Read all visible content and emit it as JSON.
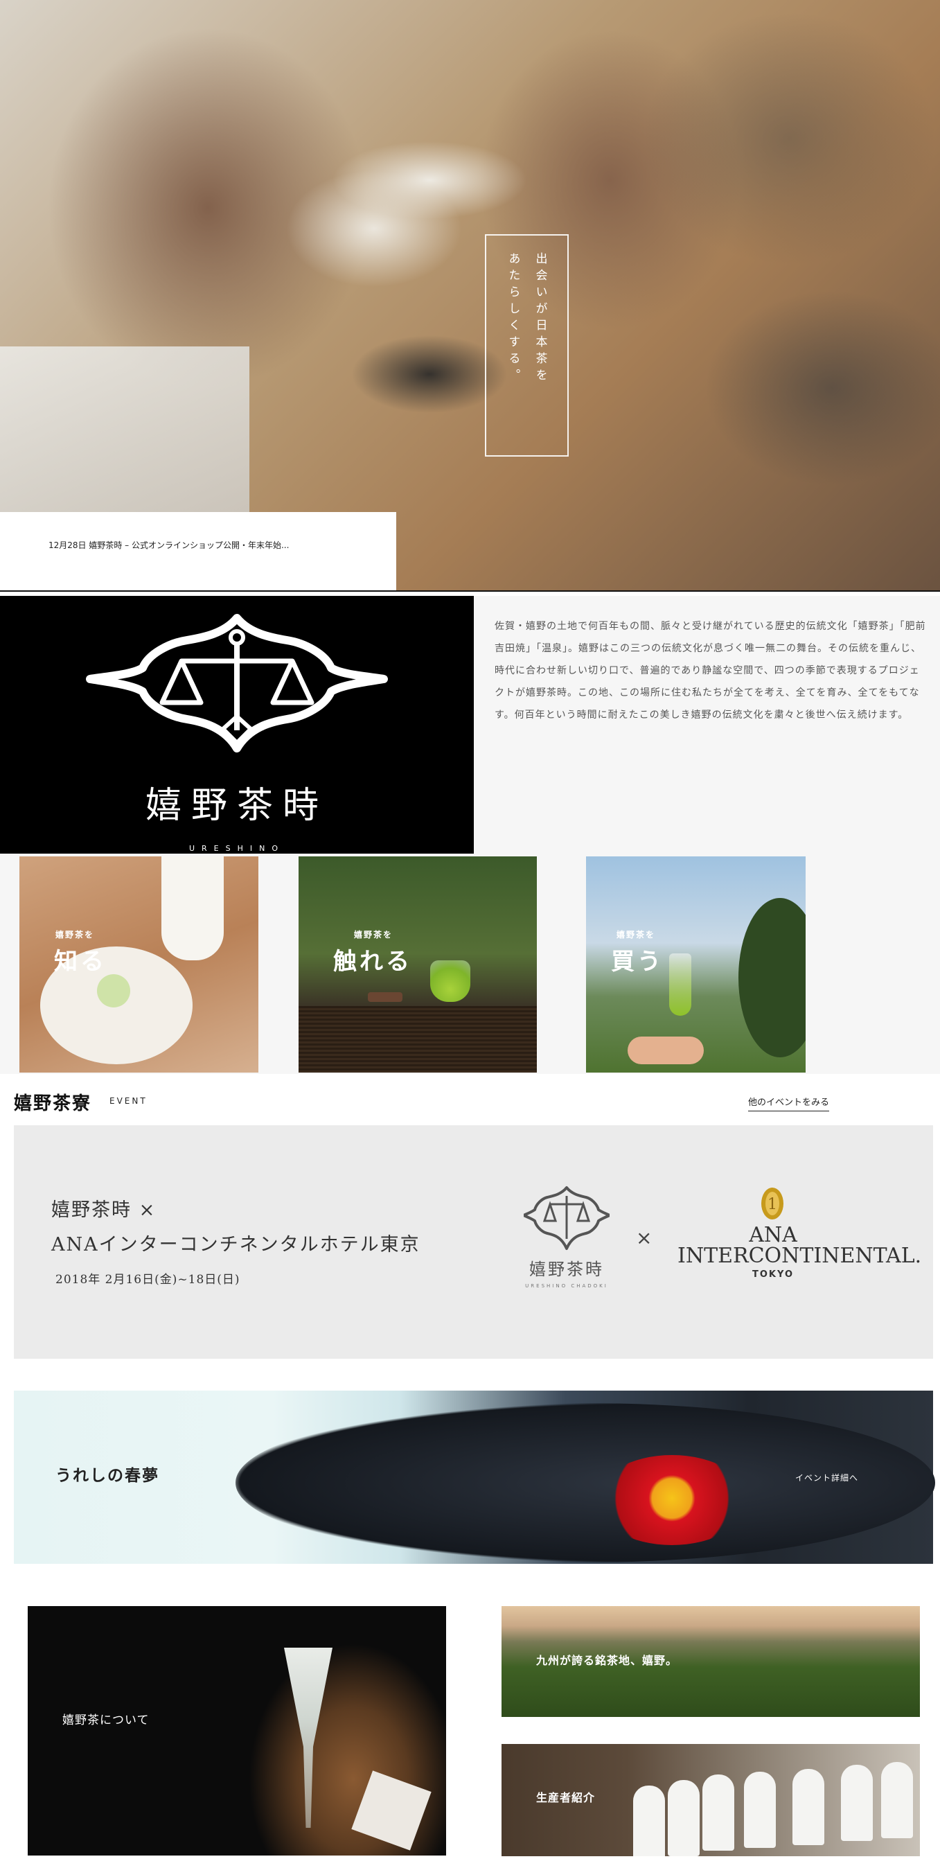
{
  "hero": {
    "tagline_line1": "出会いが日本茶を",
    "tagline_line2": "あたらしくする。",
    "news": "12月28日 嬉野茶時 – 公式オンラインショップ公開・年末年始..."
  },
  "logo": {
    "kanji": "嬉野茶時",
    "roman": "URESHINO"
  },
  "intro": {
    "text": "佐賀・嬉野の土地で何百年もの間、脈々と受け継がれている歴史的伝統文化「嬉野茶」「肥前吉田焼」「温泉」。嬉野はこの三つの伝統文化が息づく唯一無二の舞台。その伝統を重んじ、時代に合わせ新しい切り口で、普遍的であり静謐な空間で、四つの季節で表現するプロジェクトが嬉野茶時。この地、この場所に住む私たちが全てを考え、全てを育み、全てをもてなす。何百年という時間に耐えたこの美しき嬉野の伝統文化を粛々と後世へ伝え続けます。"
  },
  "cards": [
    {
      "sub": "嬉野茶を",
      "title": "知る"
    },
    {
      "sub": "嬉野茶を",
      "title": "触れる"
    },
    {
      "sub": "嬉野茶を",
      "title": "買う"
    }
  ],
  "event": {
    "section_title": "嬉野茶寮",
    "section_label": "EVENT",
    "more_link": "他のイベントをみる",
    "line1": "嬉野茶時 ×",
    "line2": "ANAインターコンチネンタルホテル東京",
    "date": "2018年 2月16日(金)~18日(日)",
    "logo_kanji": "嬉野茶時",
    "logo_roman": "URESHINO CHADOKI",
    "times": "×",
    "partner_name_line1": "ANA",
    "partner_name_line2": "INTERCONTINENTAL.",
    "partner_sub": "TOKYO"
  },
  "spring": {
    "title": "うれしの春夢",
    "link": "イベント詳細へ"
  },
  "tiles": {
    "about": "嬉野茶について",
    "field": "九州が誇る銘茶地、嬉野。",
    "growers": "生産者紹介"
  },
  "colors": {
    "black": "#000000",
    "panel_gray": "#ebebeb",
    "light_gray": "#f6f6f6",
    "mint": "#e6f4f4",
    "camellia_red": "#d8131e"
  }
}
